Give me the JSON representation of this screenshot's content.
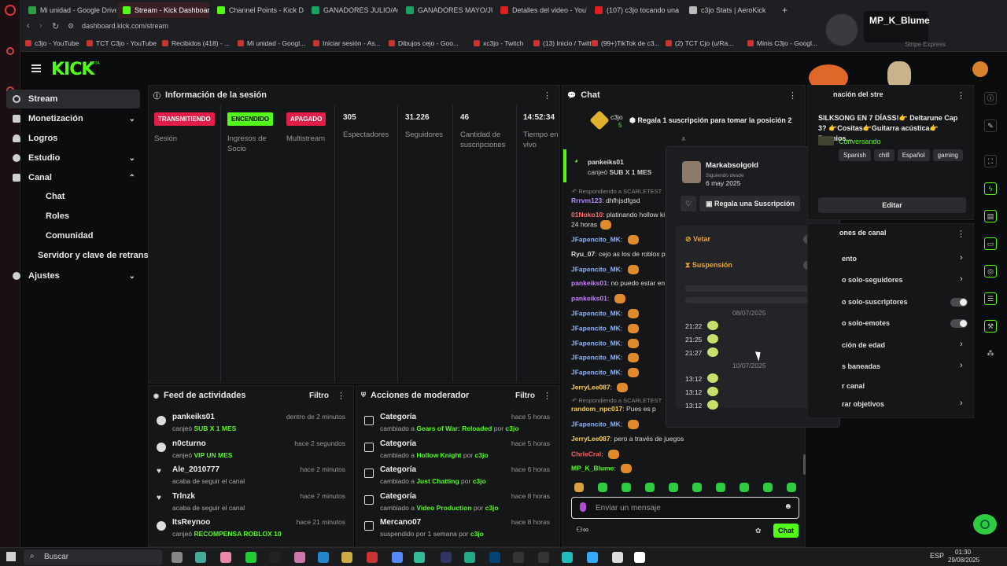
{
  "browser": {
    "tabs": [
      {
        "label": "Mi unidad - Google Drive",
        "color": "#2f9e44"
      },
      {
        "label": "Stream - Kick Dashboard",
        "color": "#53fc18"
      },
      {
        "label": "Channel Points - Kick Da",
        "color": "#53fc18"
      },
      {
        "label": "GANADORES JULIO/AGO",
        "color": "#1aa260"
      },
      {
        "label": "GANADORES MAYO/JUN",
        "color": "#1aa260"
      },
      {
        "label": "Detalles del video - YouT",
        "color": "#e02020"
      },
      {
        "label": "(107) c3jo tocando una c",
        "color": "#e02020"
      },
      {
        "label": "c3jo Stats | AeroKick",
        "color": "#bbbbbb"
      }
    ],
    "url": "dashboard.kick.com/stream",
    "bookmarks": [
      "c3jo - YouTube",
      "TCT C3jo - YouTube",
      "Recibidos (418) - ...",
      "Mi unidad - Googl...",
      "Iniciar sesión - As...",
      "Dibujos cejo - Goo...",
      "xc3jo - Twitch",
      "(13) Inicio / Twitter",
      "(99+)TikTok de c3...",
      "(2) TCT Cjo (u/Ra...",
      "Minis C3jo - Googl..."
    ],
    "overlay_name": "MP_K_Blume",
    "overlay_extra": "Stripe Express",
    "overlay_mult_a": "x10",
    "overlay_mult_b": "x2"
  },
  "logo": "KICK",
  "logo_badge": "BETA",
  "nav": {
    "items": [
      "Stream",
      "Monetización",
      "Logros",
      "Estudio",
      "Canal"
    ],
    "sub": [
      "Chat",
      "Roles",
      "Comunidad"
    ],
    "server": "Servidor y clave de retrans",
    "settings": "Ajustes"
  },
  "session": {
    "title": "Información de la sesión",
    "stats": [
      {
        "value": "TRANSMITIENDO",
        "label": "Sesión"
      },
      {
        "value": "ENCENDIDO",
        "label": "Ingresos de Socio"
      },
      {
        "value": "APAGADO",
        "label": "Multistream"
      },
      {
        "value": "305",
        "label": "Espectadores"
      },
      {
        "value": "31.226",
        "label": "Seguidores"
      },
      {
        "value": "46",
        "label": "Cantidad de suscripciones"
      },
      {
        "value": "14:52:34",
        "label": "Tiempo en vivo"
      }
    ]
  },
  "feed": {
    "title": "Feed de actividades",
    "filter": "Filtro",
    "items": [
      {
        "name": "pankeiks01",
        "prefix": "canjeó",
        "hl": "SUB X 1 MES",
        "time": "dentro de 2 minutos"
      },
      {
        "name": "n0cturno",
        "prefix": "canjeó",
        "hl": "VIP UN MES",
        "time": "hace 2 segundos"
      },
      {
        "name": "Ale_2010777",
        "prefix": "acaba de seguir el canal",
        "hl": "",
        "time": "hace 2 minutos"
      },
      {
        "name": "Trlnzk",
        "prefix": "acaba de seguir el canal",
        "hl": "",
        "time": "hace 7 minutos"
      },
      {
        "name": "ItsReynoo",
        "prefix": "canjeó",
        "hl": "RECOMPENSA ROBLOX 10",
        "time": "hace 21 minutos"
      }
    ]
  },
  "mod": {
    "title": "Acciones de moderador",
    "filter": "Filtro",
    "items": [
      {
        "name": "Categoría",
        "prefix": "cambiado a",
        "hl": "Gears of War: Reloaded",
        "by": "por",
        "who": "c3jo",
        "time": "hace 5 horas"
      },
      {
        "name": "Categoría",
        "prefix": "cambiado a",
        "hl": "Hollow Knight",
        "by": "por",
        "who": "c3jo",
        "time": "hace 5 horas"
      },
      {
        "name": "Categoría",
        "prefix": "cambiado a",
        "hl": "Just Chatting",
        "by": "por",
        "who": "c3jo",
        "time": "hace 6 horas"
      },
      {
        "name": "Categoría",
        "prefix": "cambiado a",
        "hl": "Video Production",
        "by": "por",
        "who": "c3jo",
        "time": "hace 8 horas"
      },
      {
        "name": "Mercano07",
        "prefix": "suspendido por 1 semana por",
        "hl": "",
        "by": "",
        "who": "c3jo",
        "time": "hace 8 horas"
      }
    ]
  },
  "chat": {
    "title": "Chat",
    "pin_user": "c3jo",
    "pin_count": "5",
    "pin_text": "Regala 1 suscripción para tomar la posición 2",
    "highlight_user": "pankeiks01",
    "highlight_text": "canjeó",
    "highlight_bold": "SUB X 1 MES",
    "reply_prefix": "Respondiendo a SCARLETEST",
    "input_placeholder": "Enviar un mensaje",
    "send": "Chat",
    "messages": [
      {
        "user": "Rrrvm123",
        "text": "dhfhjsdfgsd",
        "color": "#b388ff"
      },
      {
        "user": "01Noko10",
        "text": "platinando hollow ki",
        "color": "#ff6b6b"
      },
      {
        "user": "",
        "text": "24 horas",
        "color": "#ddd"
      },
      {
        "user": "JFapencito_MK",
        "text": "",
        "color": "#8ab4ff"
      },
      {
        "user": "Ryu_07",
        "text": "cejo as los de roblox p",
        "color": "#ddd"
      },
      {
        "user": "JFapencito_MK",
        "text": "",
        "color": "#8ab4ff"
      },
      {
        "user": "pankeiks01",
        "text": "no puedo estar en",
        "color": "#c77dff"
      },
      {
        "user": "pankeiks01",
        "text": "",
        "color": "#c77dff"
      },
      {
        "user": "JFapencito_MK",
        "text": "",
        "color": "#8ab4ff"
      },
      {
        "user": "JFapencito_MK",
        "text": "",
        "color": "#8ab4ff"
      },
      {
        "user": "JFapencito_MK",
        "text": "",
        "color": "#8ab4ff"
      },
      {
        "user": "JFapencito_MK",
        "text": "",
        "color": "#8ab4ff"
      },
      {
        "user": "JFapencito_MK",
        "text": "",
        "color": "#8ab4ff"
      },
      {
        "user": "JerryLee087",
        "text": "",
        "color": "#ffcf4d"
      },
      {
        "user": "random_npc017",
        "text": "Pues es p",
        "color": "#ffcf4d"
      },
      {
        "user": "JFapencito_MK",
        "text": "",
        "color": "#8ab4ff"
      },
      {
        "user": "JerryLee087",
        "text": "pero a través de juegos",
        "color": "#ffcf4d"
      },
      {
        "user": "ChrleCral",
        "text": "",
        "color": "#ff5c5c"
      },
      {
        "user": "MP_K_Blume",
        "text": "",
        "color": "#53fc18"
      }
    ]
  },
  "popup": {
    "user": "Markabsolgold",
    "since_label": "Siguiendo desde",
    "since": "6 may 2025",
    "gift": "Regala una Suscripción",
    "ban": "Vetar",
    "timeout": "Suspensión",
    "date1": "08/07/2025",
    "times1": [
      "21:22",
      "21:25",
      "21:27"
    ],
    "date2": "10/07/2025",
    "times2": [
      "13:12",
      "13:12",
      "13:12"
    ]
  },
  "right": {
    "title": "nación del stre",
    "stream_title": "SILKSONG EN 7 DÍASS!👉 Deltarune Cap 3? 👉Cositas👉Guitarra acústica👉Premios...",
    "category": "Conversando",
    "tags": [
      "Spanish",
      "chill",
      "Español",
      "gaming"
    ],
    "edit": "Editar",
    "actions_title": "ones de canal",
    "actions": [
      "ento",
      "o solo-seguidores",
      "o solo-suscriptores",
      "o solo-emotes",
      "ción de edad",
      "s baneadas",
      "r canal",
      "rar objetivos"
    ]
  },
  "taskbar": {
    "search": "Buscar",
    "lang": "ESP",
    "time": "01:30",
    "date": "29/08/2025"
  }
}
